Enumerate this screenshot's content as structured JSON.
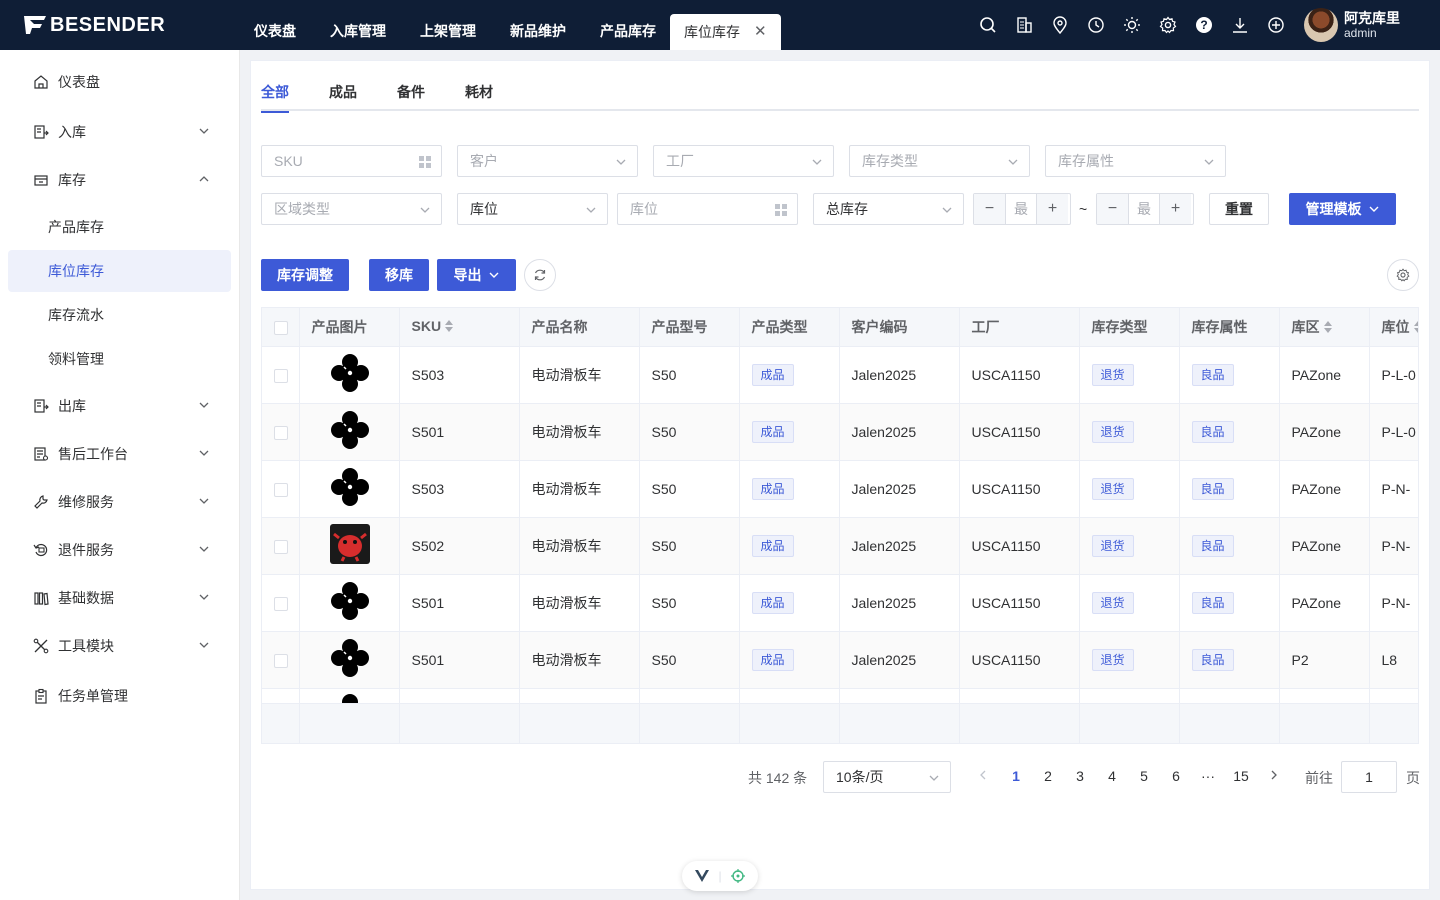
{
  "brand": {
    "logo_text": "BESENDER"
  },
  "top_nav": [
    {
      "label": "仪表盘"
    },
    {
      "label": "入库管理"
    },
    {
      "label": "上架管理"
    },
    {
      "label": "新品维护"
    },
    {
      "label": "产品库存"
    },
    {
      "label": "库位库存",
      "active": true
    }
  ],
  "top_icons": [
    "search-icon",
    "building-icon",
    "location-icon",
    "clock-icon",
    "sun-icon",
    "gear-icon",
    "help-icon",
    "download-icon",
    "plus-circle-icon"
  ],
  "user": {
    "name": "阿克库里",
    "role": "admin"
  },
  "sidebar": {
    "items": [
      {
        "label": "仪表盘",
        "icon": "home-icon"
      },
      {
        "label": "入库",
        "icon": "inbound-icon",
        "chevron": "down"
      },
      {
        "label": "库存",
        "icon": "inventory-icon",
        "chevron": "up"
      },
      {
        "label": "出库",
        "icon": "outbound-icon",
        "chevron": "down"
      },
      {
        "label": "售后工作台",
        "icon": "aftersale-icon",
        "chevron": "down"
      },
      {
        "label": "维修服务",
        "icon": "wrench-icon",
        "chevron": "down"
      },
      {
        "label": "退件服务",
        "icon": "return-icon",
        "chevron": "down"
      },
      {
        "label": "基础数据",
        "icon": "data-icon",
        "chevron": "down"
      },
      {
        "label": "工具模块",
        "icon": "tools-icon",
        "chevron": "down"
      },
      {
        "label": "任务单管理",
        "icon": "task-icon"
      }
    ],
    "sub_items": [
      {
        "label": "产品库存"
      },
      {
        "label": "库位库存",
        "active": true
      },
      {
        "label": "库存流水"
      },
      {
        "label": "领料管理"
      }
    ]
  },
  "tabs": [
    {
      "label": "全部",
      "active": true
    },
    {
      "label": "成品"
    },
    {
      "label": "备件"
    },
    {
      "label": "耗材"
    }
  ],
  "filters": {
    "sku": "SKU",
    "customer": "客户",
    "factory": "工厂",
    "stock_type": "库存类型",
    "stock_attr": "库存属性",
    "area_type": "区域类型",
    "location_select": "库位",
    "location_input": "库位",
    "total_stock": "总库存",
    "min1": "最",
    "min2": "最",
    "tilde": "~"
  },
  "buttons": {
    "reset": "重置",
    "template": "管理模板",
    "adjust": "库存调整",
    "move": "移库",
    "export": "导出"
  },
  "table": {
    "headers": [
      "产品图片",
      "SKU",
      "产品名称",
      "产品型号",
      "产品类型",
      "客户编码",
      "工厂",
      "库存类型",
      "库存属性",
      "库区",
      "库位"
    ],
    "rows": [
      {
        "img": "clover",
        "sku": "S503",
        "name": "电动滑板车",
        "model": "S50",
        "type": "成品",
        "customer": "Jalen2025",
        "factory": "USCA1150",
        "stock_type": "退货",
        "stock_attr": "良品",
        "zone": "PAZone",
        "location": "P-L-0"
      },
      {
        "img": "clover",
        "sku": "S501",
        "name": "电动滑板车",
        "model": "S50",
        "type": "成品",
        "customer": "Jalen2025",
        "factory": "USCA1150",
        "stock_type": "退货",
        "stock_attr": "良品",
        "zone": "PAZone",
        "location": "P-L-0"
      },
      {
        "img": "clover",
        "sku": "S503",
        "name": "电动滑板车",
        "model": "S50",
        "type": "成品",
        "customer": "Jalen2025",
        "factory": "USCA1150",
        "stock_type": "退货",
        "stock_attr": "良品",
        "zone": "PAZone",
        "location": "P-N-"
      },
      {
        "img": "red-creature",
        "sku": "S502",
        "name": "电动滑板车",
        "model": "S50",
        "type": "成品",
        "customer": "Jalen2025",
        "factory": "USCA1150",
        "stock_type": "退货",
        "stock_attr": "良品",
        "zone": "PAZone",
        "location": "P-N-"
      },
      {
        "img": "clover",
        "sku": "S501",
        "name": "电动滑板车",
        "model": "S50",
        "type": "成品",
        "customer": "Jalen2025",
        "factory": "USCA1150",
        "stock_type": "退货",
        "stock_attr": "良品",
        "zone": "PAZone",
        "location": "P-N-"
      },
      {
        "img": "clover",
        "sku": "S501",
        "name": "电动滑板车",
        "model": "S50",
        "type": "成品",
        "customer": "Jalen2025",
        "factory": "USCA1150",
        "stock_type": "退货",
        "stock_attr": "良品",
        "zone": "P2",
        "location": "L8"
      }
    ]
  },
  "pagination": {
    "total": "共 142 条",
    "page_size": "10条/页",
    "pages": [
      "1",
      "2",
      "3",
      "4",
      "5",
      "6",
      "15"
    ],
    "ellipsis": "···",
    "current": "1",
    "goto_label": "前往",
    "goto_value": "1",
    "page_unit": "页"
  },
  "colors": {
    "primary": "#3d5ad7",
    "topbar": "#0f1e36"
  }
}
